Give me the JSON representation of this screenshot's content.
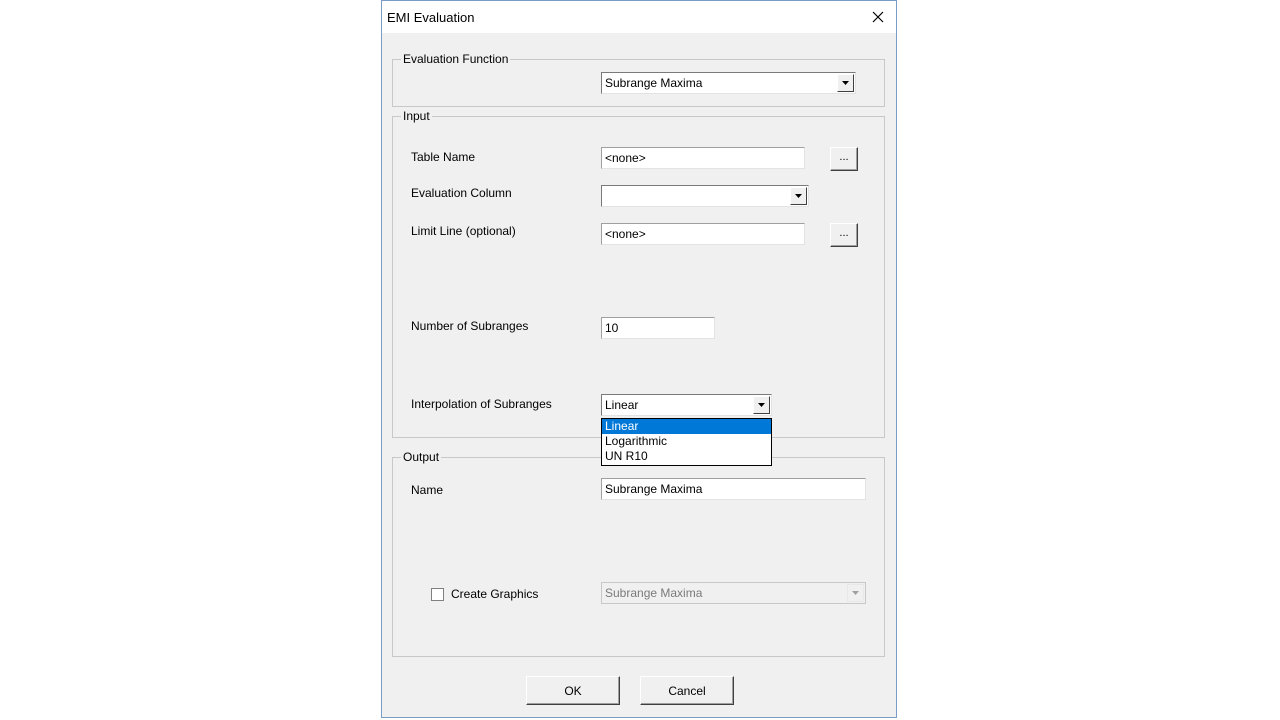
{
  "window": {
    "title": "EMI Evaluation"
  },
  "evaluation_function": {
    "legend": "Evaluation Function",
    "selected": "Subrange Maxima"
  },
  "input": {
    "legend": "Input",
    "table_name_label": "Table Name",
    "table_name_value": "<none>",
    "browse_label": "...",
    "evaluation_column_label": "Evaluation Column",
    "evaluation_column_value": "",
    "limit_line_label": "Limit Line (optional)",
    "limit_line_value": "<none>",
    "num_subranges_label": "Number of Subranges",
    "num_subranges_value": "10",
    "interpolation_label": "Interpolation of Subranges",
    "interpolation_value": "Linear",
    "interpolation_options": [
      "Linear",
      "Logarithmic",
      "UN R10"
    ]
  },
  "output": {
    "legend": "Output",
    "name_label": "Name",
    "name_value": "Subrange Maxima",
    "create_graphics_label": "Create Graphics",
    "create_graphics_checked": false,
    "graphics_value": "Subrange Maxima"
  },
  "buttons": {
    "ok": "OK",
    "cancel": "Cancel"
  }
}
